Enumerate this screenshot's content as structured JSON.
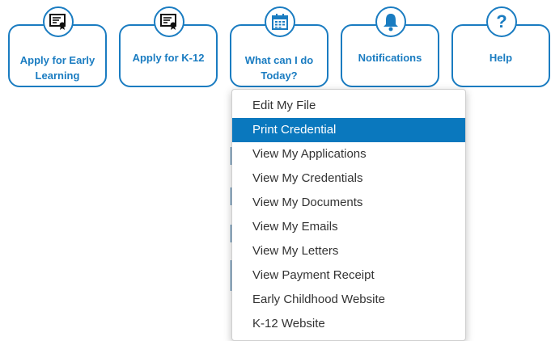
{
  "tiles": [
    {
      "label": "Apply for Early\nLearning",
      "icon": "certificate-icon"
    },
    {
      "label": "Apply for K-12",
      "icon": "certificate-icon"
    },
    {
      "label": "What can I do\nToday?",
      "icon": "calendar-icon"
    },
    {
      "label": "Notifications",
      "icon": "bell-icon"
    },
    {
      "label": "Help",
      "icon": "question-icon"
    }
  ],
  "menu": {
    "selected_index": 1,
    "items": [
      "Edit My File",
      "Print Credential",
      "View My Applications",
      "View My Credentials",
      "View My Documents",
      "View My Emails",
      "View My Letters",
      "View Payment Receipt",
      "Early Childhood Website",
      "K-12 Website"
    ]
  },
  "colors": {
    "accent": "#1a7cc1",
    "highlight": "#0a78be"
  }
}
